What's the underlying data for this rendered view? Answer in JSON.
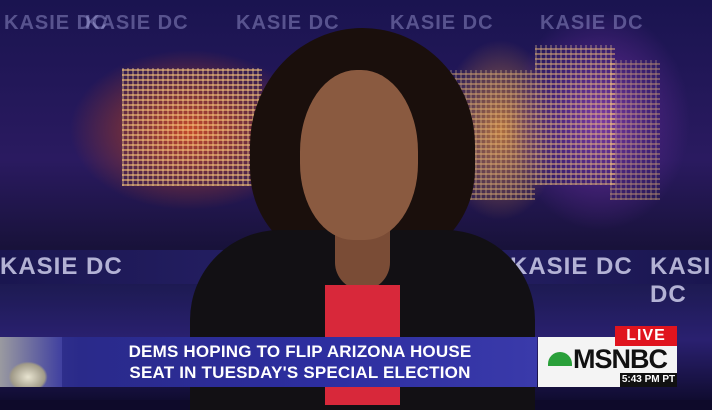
{
  "watermark": "KASIE DC",
  "lower_third": {
    "line1": "DEMS HOPING TO FLIP ARIZONA HOUSE",
    "line2": "SEAT IN TUESDAY'S SPECIAL ELECTION"
  },
  "bug": {
    "live": "LIVE",
    "network": "MSNBC",
    "time": "5:43 PM PT"
  },
  "colors": {
    "live": "#e0141e",
    "banner": "#2d2ea0"
  }
}
